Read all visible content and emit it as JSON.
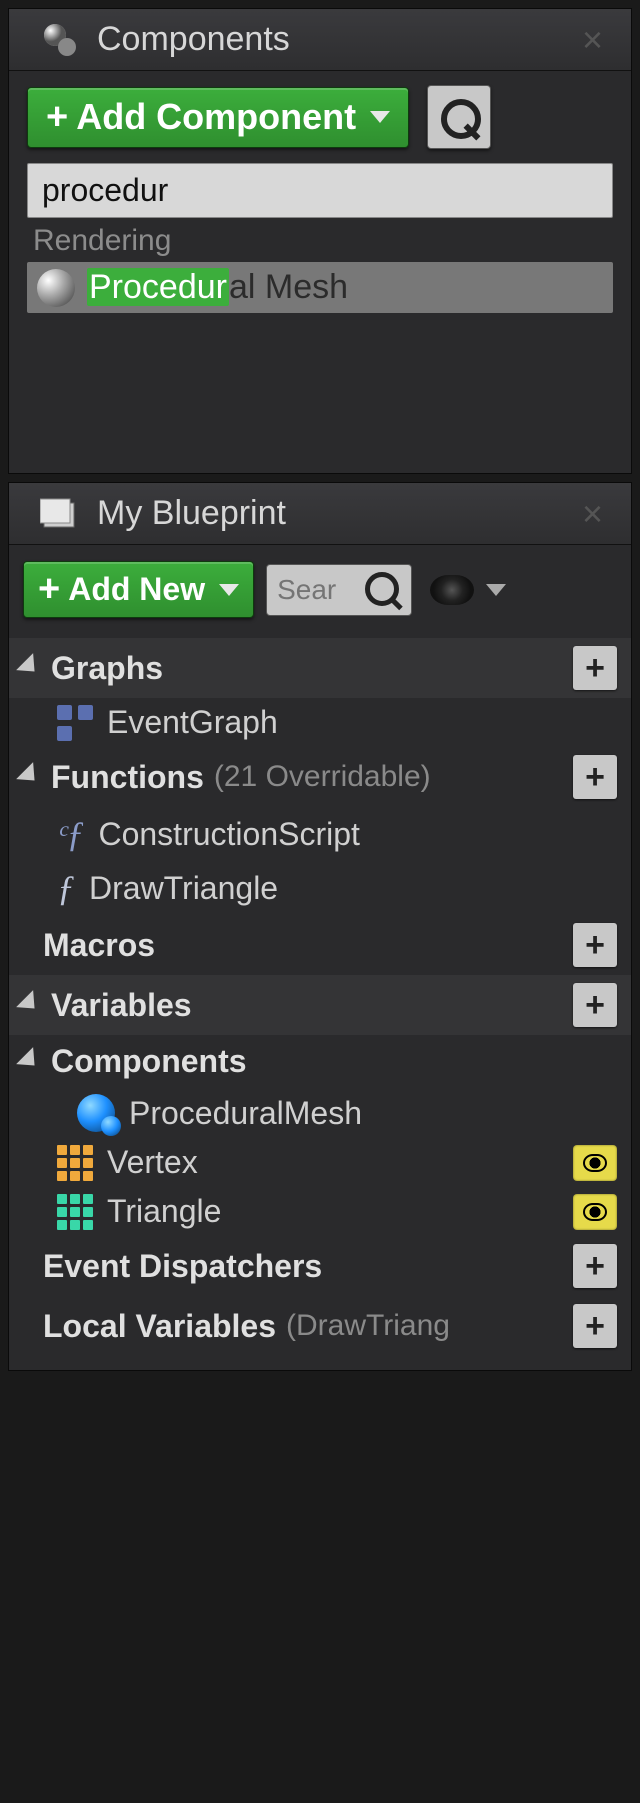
{
  "components_panel": {
    "tab_title": "Components",
    "add_button_label": "Add Component",
    "search_value": "procedur",
    "category": "Rendering",
    "result": {
      "highlight": "Procedur",
      "rest": "al Mesh"
    }
  },
  "blueprint_panel": {
    "tab_title": "My Blueprint",
    "add_button_label": "Add New",
    "search_placeholder": "Sear",
    "sections": {
      "graphs": {
        "label": "Graphs",
        "items": [
          {
            "label": "EventGraph"
          }
        ]
      },
      "functions": {
        "label": "Functions",
        "note": "(21 Overridable)",
        "items": [
          {
            "label": "ConstructionScript"
          },
          {
            "label": "DrawTriangle"
          }
        ]
      },
      "macros": {
        "label": "Macros"
      },
      "variables": {
        "label": "Variables"
      },
      "components": {
        "label": "Components",
        "items": [
          {
            "label": "ProceduralMesh"
          },
          {
            "label": "Vertex"
          },
          {
            "label": "Triangle"
          }
        ]
      },
      "event_dispatchers": {
        "label": "Event Dispatchers"
      },
      "local_variables": {
        "label": "Local Variables",
        "note": "(DrawTriang"
      }
    }
  }
}
